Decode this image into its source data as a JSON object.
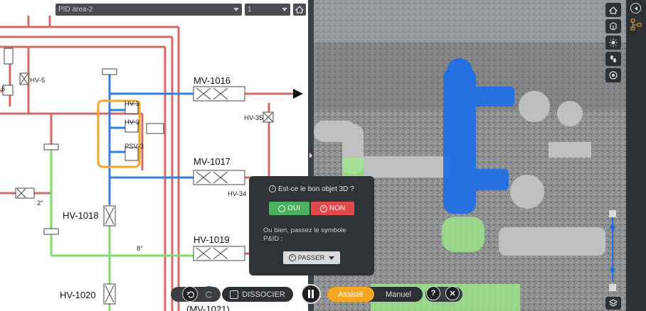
{
  "toolbar": {
    "area_select": "PID area-2",
    "page_select": "1"
  },
  "pid_labels": {
    "mv1016": "MV-1016",
    "mv1017": "MV-1017",
    "hv1018": "HV-1018",
    "hv1019": "HV-1019",
    "hv1020": "HV-1020",
    "mv1021": "(MV-1021)",
    "hv5": "HV-5",
    "hv35": "HV-35",
    "hv34": "HV-34",
    "hv3a": "HV-3",
    "hv3b": "HV-3",
    "psv3": "PSV-3",
    "six": "6",
    "two_in": "2\"",
    "eight_in": "8\""
  },
  "popup": {
    "question": "Est-ce le bon objet 3D ?",
    "yes": "OUI",
    "no": "NON",
    "or_text": "Ou bien, passez le symbole P&ID :",
    "skip": "PASSER"
  },
  "bottom": {
    "dissocier": "DISSOCIER",
    "assiste": "Assisté",
    "manuel": "Manuel",
    "help": "?"
  },
  "colors": {
    "accent": "#f5a623",
    "highlight_blue": "#1f6ee8",
    "pipe_red": "#d56a64",
    "pipe_blue": "#2e7fe0",
    "pipe_green": "#7fdc6a"
  },
  "icons": {
    "home": "home-icon",
    "undo": "undo-icon",
    "redo": "redo-icon",
    "dissociate": "dissociate-icon",
    "pause": "pause-icon",
    "help": "help-icon",
    "close": "close-icon"
  }
}
